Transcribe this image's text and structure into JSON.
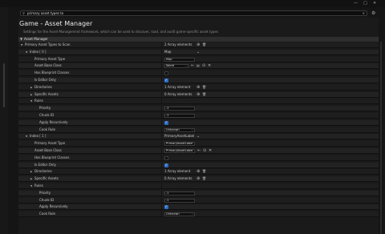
{
  "window": {
    "controls": [
      "—",
      "□",
      "✕"
    ]
  },
  "search": {
    "value": "primary asset types to",
    "clear": "✕"
  },
  "header": {
    "title": "Game - Asset Manager",
    "description": "Settings for the Asset Management framework, which can be used to discover, load, and audit game-specific asset types"
  },
  "category": {
    "label": "Asset Manager"
  },
  "rows": [
    {
      "indent": 0,
      "expand": "▼",
      "label": "Primary Asset Types to Scan",
      "value": "2 Array elements",
      "icons": [
        "plus",
        "trash"
      ]
    },
    {
      "indent": 1,
      "expand": "▼",
      "label": "Index [ 0 ]",
      "value": "Map",
      "icons": [
        "chevron"
      ]
    },
    {
      "indent": 2,
      "label": "Primary Asset Type",
      "input": "Map",
      "inputWidth": 38
    },
    {
      "indent": 2,
      "label": "Asset Base Class",
      "dropdown": "World",
      "dropWidth": 30,
      "icons": [
        "back",
        "browse",
        "use",
        "clear"
      ]
    },
    {
      "indent": 2,
      "label": "Has Blueprint Classes",
      "check": false
    },
    {
      "indent": 2,
      "label": "Is Editor Only",
      "check": true
    },
    {
      "indent": 2,
      "expand": "▶",
      "label": "Directories",
      "value": "1 Array element",
      "icons": [
        "plus",
        "trash"
      ]
    },
    {
      "indent": 2,
      "expand": "▶",
      "label": "Specific Assets",
      "value": "0 Array elements",
      "icons": [
        "plus",
        "trash"
      ]
    },
    {
      "indent": 2,
      "expand": "▼",
      "label": "Rules"
    },
    {
      "indent": 3,
      "label": "Priority",
      "input": "-1",
      "inputWidth": 38
    },
    {
      "indent": 3,
      "label": "Chunk ID",
      "input": "-1",
      "inputWidth": 38
    },
    {
      "indent": 3,
      "label": "Apply Recursively",
      "check": true
    },
    {
      "indent": 3,
      "label": "Cook Rule",
      "dropdown": "Unknown",
      "dropWidth": 38
    },
    {
      "indent": 1,
      "expand": "▼",
      "label": "Index [ 1 ]",
      "value": "PrimaryAssetLabel",
      "icons": [
        "chevron"
      ]
    },
    {
      "indent": 2,
      "label": "Primary Asset Type",
      "input": "PrimaryAssetLabel",
      "inputWidth": 38
    },
    {
      "indent": 2,
      "label": "Asset Base Class",
      "dropdown": "PrimaryAssetLabel",
      "dropWidth": 38,
      "icons": [
        "back",
        "use",
        "clear"
      ]
    },
    {
      "indent": 2,
      "label": "Has Blueprint Classes",
      "check": false
    },
    {
      "indent": 2,
      "label": "Is Editor Only",
      "check": true
    },
    {
      "indent": 2,
      "expand": "▶",
      "label": "Directories",
      "value": "1 Array element",
      "icons": [
        "plus",
        "trash"
      ]
    },
    {
      "indent": 2,
      "expand": "▶",
      "label": "Specific Assets",
      "value": "0 Array elements",
      "icons": [
        "plus",
        "trash"
      ]
    },
    {
      "indent": 2,
      "expand": "▼",
      "label": "Rules"
    },
    {
      "indent": 3,
      "label": "Priority",
      "input": "-1",
      "inputWidth": 38
    },
    {
      "indent": 3,
      "label": "Chunk ID",
      "input": "-1",
      "inputWidth": 38
    },
    {
      "indent": 3,
      "label": "Apply Recursively",
      "check": true
    },
    {
      "indent": 3,
      "label": "Cook Rule",
      "dropdown": "Unknown",
      "dropWidth": 38
    }
  ],
  "icons": {
    "plus": "⊕",
    "trash": "🗑",
    "chevron": "⌄",
    "back": "←",
    "browse": "▤",
    "use": "⊙",
    "clear": "✕"
  }
}
